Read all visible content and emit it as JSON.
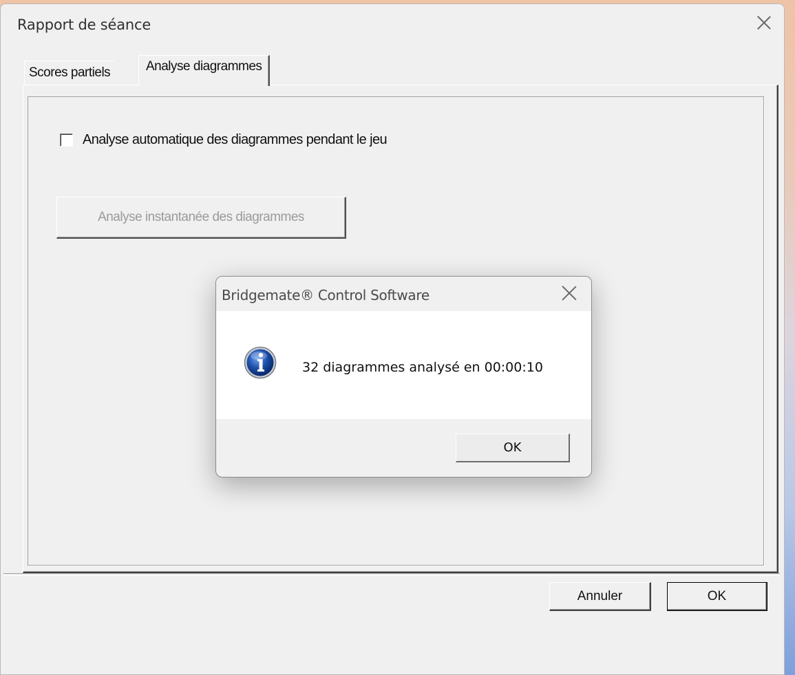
{
  "window": {
    "title": "Rapport de séance"
  },
  "tabs": [
    {
      "label": "Scores partiels",
      "active": false
    },
    {
      "label": "Analyse diagrammes",
      "active": true
    }
  ],
  "panel": {
    "auto_analysis_label": "Analyse automatique des diagrammes pendant le jeu",
    "auto_analysis_checked": false,
    "instant_analysis_button": "Analyse instantanée des diagrammes"
  },
  "footer": {
    "cancel_label": "Annuler",
    "ok_label": "OK"
  },
  "modal": {
    "title": "Bridgemate® Control Software",
    "message": "32 diagrammes analysé en 00:00:10",
    "ok_label": "OK",
    "icon": "info-icon"
  },
  "colors": {
    "info_icon_blue": "#1c4fa8",
    "disabled_text": "#9a9a9a"
  }
}
